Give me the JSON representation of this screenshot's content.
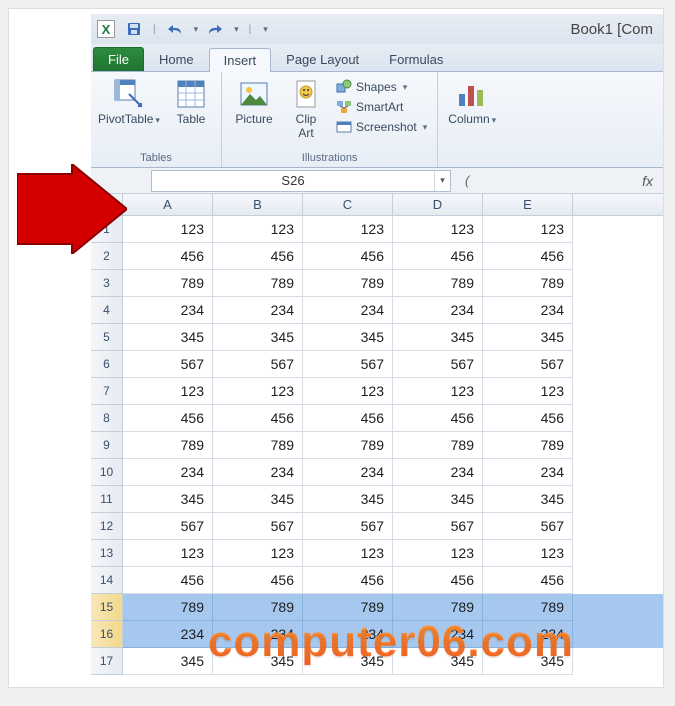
{
  "title": {
    "doc_name": "Book1  [Com"
  },
  "qat": {
    "save": "💾",
    "undo": "↶",
    "redo": "↷"
  },
  "tabs": {
    "file": "File",
    "items": [
      "Home",
      "Insert",
      "Page Layout",
      "Formulas"
    ],
    "active_index": 1
  },
  "ribbon": {
    "tables": {
      "label": "Tables",
      "pivot": "PivotTable",
      "table": "Table"
    },
    "illustrations": {
      "label": "Illustrations",
      "picture": "Picture",
      "clipart_l1": "Clip",
      "clipart_l2": "Art",
      "shapes": "Shapes",
      "smartart": "SmartArt",
      "screenshot": "Screenshot"
    },
    "charts": {
      "column": "Column"
    }
  },
  "namebox": {
    "value": "S26"
  },
  "fx_label": "fx",
  "columns": [
    "A",
    "B",
    "C",
    "D",
    "E"
  ],
  "rows": [
    {
      "n": 1,
      "v": [
        123,
        123,
        123,
        123,
        123
      ]
    },
    {
      "n": 2,
      "v": [
        456,
        456,
        456,
        456,
        456
      ]
    },
    {
      "n": 3,
      "v": [
        789,
        789,
        789,
        789,
        789
      ]
    },
    {
      "n": 4,
      "v": [
        234,
        234,
        234,
        234,
        234
      ]
    },
    {
      "n": 5,
      "v": [
        345,
        345,
        345,
        345,
        345
      ]
    },
    {
      "n": 6,
      "v": [
        567,
        567,
        567,
        567,
        567
      ]
    },
    {
      "n": 7,
      "v": [
        123,
        123,
        123,
        123,
        123
      ]
    },
    {
      "n": 8,
      "v": [
        456,
        456,
        456,
        456,
        456
      ]
    },
    {
      "n": 9,
      "v": [
        789,
        789,
        789,
        789,
        789
      ]
    },
    {
      "n": 10,
      "v": [
        234,
        234,
        234,
        234,
        234
      ]
    },
    {
      "n": 11,
      "v": [
        345,
        345,
        345,
        345,
        345
      ]
    },
    {
      "n": 12,
      "v": [
        567,
        567,
        567,
        567,
        567
      ]
    },
    {
      "n": 13,
      "v": [
        123,
        123,
        123,
        123,
        123
      ]
    },
    {
      "n": 14,
      "v": [
        456,
        456,
        456,
        456,
        456
      ]
    },
    {
      "n": 15,
      "v": [
        789,
        789,
        789,
        789,
        789
      ],
      "sel": true
    },
    {
      "n": 16,
      "v": [
        234,
        234,
        234,
        234,
        234
      ],
      "sel": true
    },
    {
      "n": 17,
      "v": [
        345,
        345,
        345,
        345,
        345
      ]
    }
  ],
  "watermark": "computer06.com"
}
